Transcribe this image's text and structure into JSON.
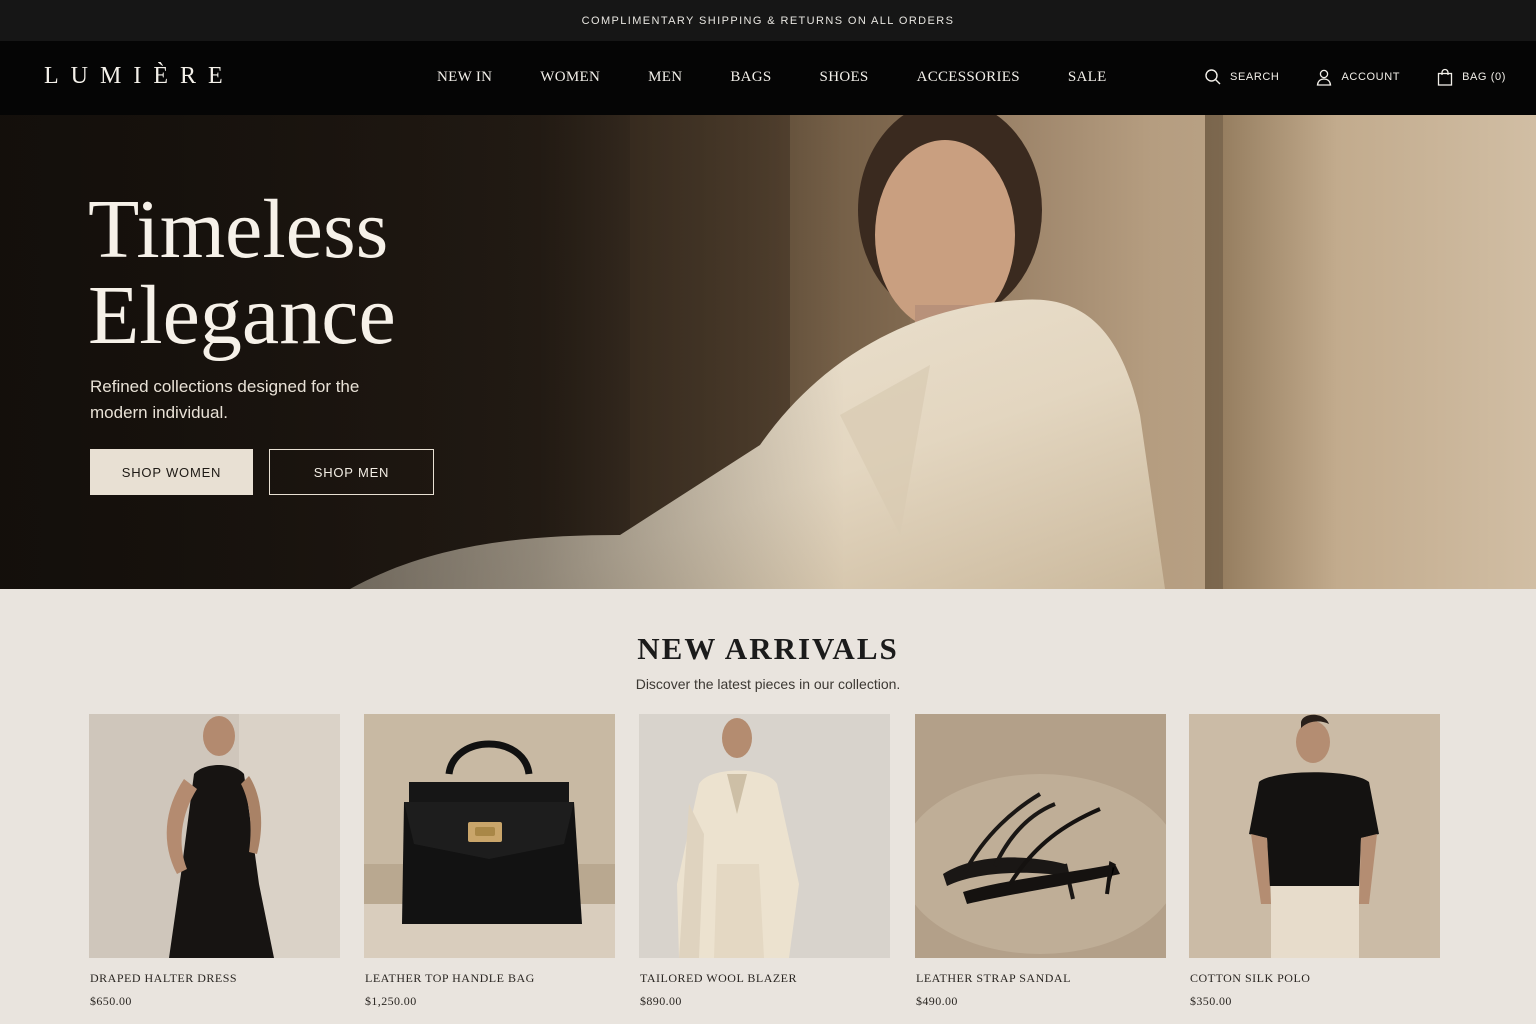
{
  "announcement": {
    "text": "COMPLIMENTARY SHIPPING & RETURNS ON ALL ORDERS"
  },
  "header": {
    "logo": "LUMIÈRE",
    "nav": [
      "NEW IN",
      "WOMEN",
      "MEN",
      "BAGS",
      "SHOES",
      "ACCESSORIES",
      "SALE"
    ],
    "search": {
      "label": "SEARCH",
      "icon": "search-icon"
    },
    "account": {
      "label": "ACCOUNT",
      "icon": "user-icon"
    },
    "bag": {
      "label": "BAG (0)",
      "icon": "shopping-bag-icon"
    }
  },
  "hero": {
    "title_line1": "Timeless",
    "title_line2": "Elegance",
    "subtitle": "Refined collections designed for the modern individual.",
    "cta_women": "SHOP WOMEN",
    "cta_men": "SHOP MEN"
  },
  "new_arrivals": {
    "title": "NEW ARRIVALS",
    "subtitle": "Discover the latest pieces in our collection.",
    "products": [
      {
        "name": "DRAPED HALTER DRESS",
        "price": "$650.00"
      },
      {
        "name": "LEATHER TOP HANDLE BAG",
        "price": "$1,250.00"
      },
      {
        "name": "TAILORED WOOL BLAZER",
        "price": "$890.00"
      },
      {
        "name": "LEATHER STRAP SANDAL",
        "price": "$490.00"
      },
      {
        "name": "COTTON SILK POLO",
        "price": "$350.00"
      }
    ]
  },
  "colors": {
    "announcement_bg": "#161616",
    "header_bg": "#050505",
    "page_bg": "#e9e4de",
    "cta_fill": "#e8e0d3"
  }
}
